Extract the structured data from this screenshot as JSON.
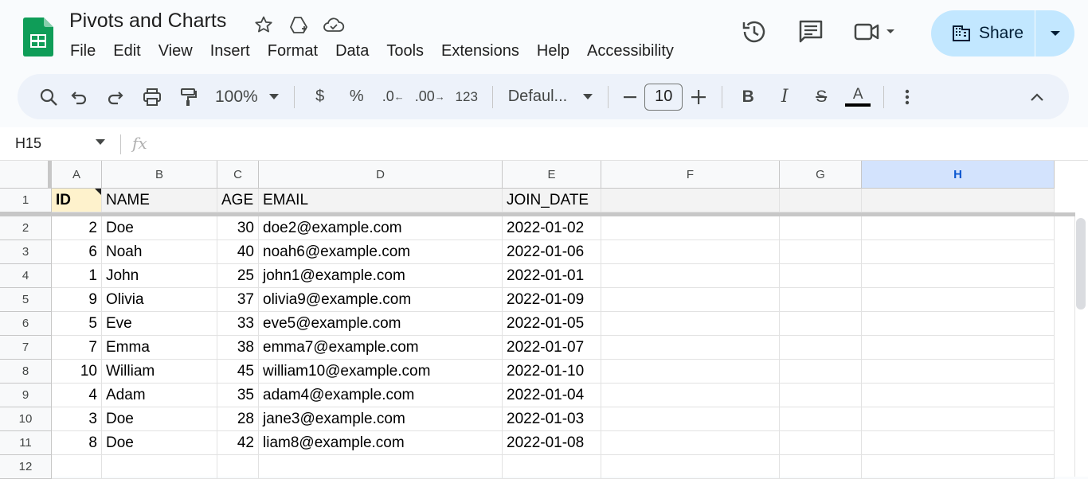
{
  "app": {
    "doc_title": "Pivots and Charts",
    "menu": [
      "File",
      "Edit",
      "View",
      "Insert",
      "Format",
      "Data",
      "Tools",
      "Extensions",
      "Help",
      "Accessibility"
    ],
    "share_label": "Share"
  },
  "toolbar": {
    "zoom": "100%",
    "currency": "$",
    "percent": "%",
    "decrease_decimal": ".0",
    "increase_decimal": ".00",
    "number_format": "123",
    "font": "Defaul...",
    "font_size": "10",
    "bold": "B",
    "italic": "I",
    "strike": "S",
    "text_color_label": "A",
    "text_color": "#000000"
  },
  "formula_bar": {
    "cell_ref": "H15",
    "fx": "fx",
    "value": ""
  },
  "sheet": {
    "columns": [
      "A",
      "B",
      "C",
      "D",
      "E",
      "F",
      "G",
      "H"
    ],
    "selected_column": "H",
    "row_numbers": [
      "1",
      "2",
      "3",
      "4",
      "5",
      "6",
      "7",
      "8",
      "9",
      "10",
      "11",
      "12"
    ],
    "header": [
      "ID",
      "NAME",
      "AGE",
      "EMAIL",
      "JOIN_DATE"
    ],
    "rows": [
      [
        "2",
        "Doe",
        "30",
        "doe2@example.com",
        "2022-01-02"
      ],
      [
        "6",
        "Noah",
        "40",
        "noah6@example.com",
        "2022-01-06"
      ],
      [
        "1",
        "John",
        "25",
        "john1@example.com",
        "2022-01-01"
      ],
      [
        "9",
        "Olivia",
        "37",
        "olivia9@example.com",
        "2022-01-09"
      ],
      [
        "5",
        "Eve",
        "33",
        "eve5@example.com",
        "2022-01-05"
      ],
      [
        "7",
        "Emma",
        "38",
        "emma7@example.com",
        "2022-01-07"
      ],
      [
        "10",
        "William",
        "45",
        "william10@example.com",
        "2022-01-10"
      ],
      [
        "4",
        "Adam",
        "35",
        "adam4@example.com",
        "2022-01-04"
      ],
      [
        "3",
        "Doe",
        "28",
        "jane3@example.com",
        "2022-01-03"
      ],
      [
        "8",
        "Doe",
        "42",
        "liam8@example.com",
        "2022-01-08"
      ]
    ]
  },
  "icons": {
    "star": "star-icon",
    "drive": "move-to-drive-icon",
    "cloud": "cloud-saved-icon",
    "history": "version-history-icon",
    "comments": "comments-icon",
    "meet": "meet-icon",
    "search": "search-menus-icon",
    "undo": "undo-icon",
    "redo": "redo-icon",
    "print": "print-icon",
    "paint": "paint-format-icon",
    "more": "more-vert-icon",
    "collapse": "collapse-toolbar-icon"
  },
  "colors": {
    "share_bg": "#c2e7ff",
    "selected_col_bg": "#d3e3fd",
    "id_header_bg": "#fef2cc",
    "logo_green": "#0f9d58"
  }
}
